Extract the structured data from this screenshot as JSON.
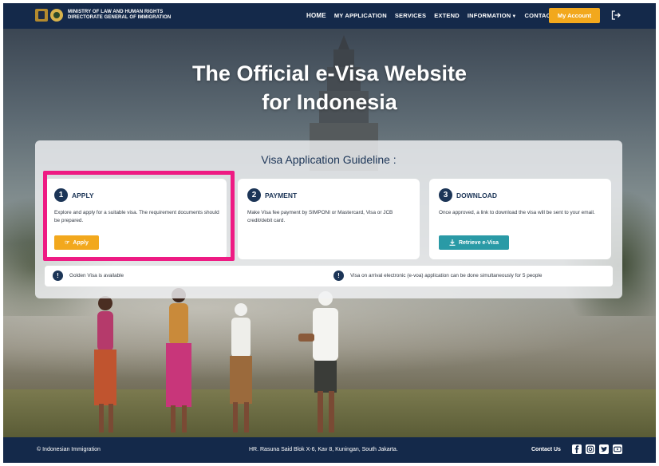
{
  "header": {
    "org_line1": "MINISTRY OF LAW AND HUMAN RIGHTS",
    "org_line2": "DIRECTORATE GENERAL OF IMMIGRATION",
    "nav": [
      {
        "label": "HOME"
      },
      {
        "label": "MY APPLICATION"
      },
      {
        "label": "SERVICES"
      },
      {
        "label": "EXTEND"
      },
      {
        "label": "INFORMATION"
      },
      {
        "label": "CONTACT US"
      }
    ],
    "account_label": "My Account",
    "colors": {
      "navy": "#14294a",
      "accent": "#f2a81d"
    }
  },
  "hero": {
    "title_line1": "The Official e-Visa Website",
    "title_line2": "for Indonesia"
  },
  "guideline": {
    "title": "Visa Application Guideline :",
    "steps": [
      {
        "number": "1",
        "title": "APPLY",
        "description": "Explore and apply for a suitable visa. The requirement documents should be prepared.",
        "button": "Apply"
      },
      {
        "number": "2",
        "title": "PAYMENT",
        "description": "Make Visa fee payment by SIMPONI or Mastercard, Visa or JCB credit/debit card."
      },
      {
        "number": "3",
        "title": "DOWNLOAD",
        "description": "Once approved, a link to download the visa will be sent to your email.",
        "button": "Retrieve e-Visa"
      }
    ],
    "notices": [
      {
        "icon": "!",
        "text": "Golden Visa is available"
      },
      {
        "icon": "!",
        "text": "Visa on arrival electronic (e-voa) application can be done simultaneously for 5 people"
      }
    ],
    "highlight_color": "#ee1b83",
    "retrieve_color": "#2a9aa6"
  },
  "footer": {
    "copyright": "© Indonesian Immigration",
    "address": "HR. Rasuna Said Blok X-6, Kav 8, Kuningan, South Jakarta.",
    "contact_label": "Contact Us",
    "social_icons": [
      "facebook-icon",
      "instagram-icon",
      "twitter-icon",
      "youtube-icon"
    ]
  }
}
